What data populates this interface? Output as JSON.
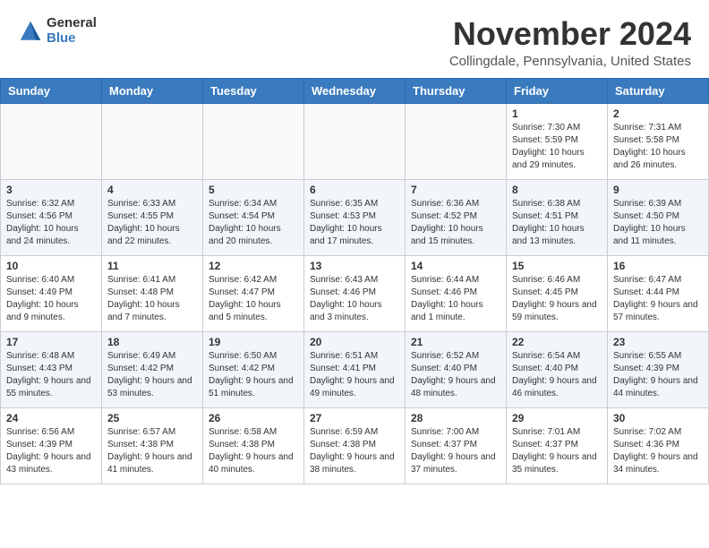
{
  "header": {
    "logo_general": "General",
    "logo_blue": "Blue",
    "month_title": "November 2024",
    "location": "Collingdale, Pennsylvania, United States"
  },
  "calendar": {
    "days_of_week": [
      "Sunday",
      "Monday",
      "Tuesday",
      "Wednesday",
      "Thursday",
      "Friday",
      "Saturday"
    ],
    "weeks": [
      [
        {
          "day": "",
          "info": ""
        },
        {
          "day": "",
          "info": ""
        },
        {
          "day": "",
          "info": ""
        },
        {
          "day": "",
          "info": ""
        },
        {
          "day": "",
          "info": ""
        },
        {
          "day": "1",
          "info": "Sunrise: 7:30 AM\nSunset: 5:59 PM\nDaylight: 10 hours and 29 minutes."
        },
        {
          "day": "2",
          "info": "Sunrise: 7:31 AM\nSunset: 5:58 PM\nDaylight: 10 hours and 26 minutes."
        }
      ],
      [
        {
          "day": "3",
          "info": "Sunrise: 6:32 AM\nSunset: 4:56 PM\nDaylight: 10 hours and 24 minutes."
        },
        {
          "day": "4",
          "info": "Sunrise: 6:33 AM\nSunset: 4:55 PM\nDaylight: 10 hours and 22 minutes."
        },
        {
          "day": "5",
          "info": "Sunrise: 6:34 AM\nSunset: 4:54 PM\nDaylight: 10 hours and 20 minutes."
        },
        {
          "day": "6",
          "info": "Sunrise: 6:35 AM\nSunset: 4:53 PM\nDaylight: 10 hours and 17 minutes."
        },
        {
          "day": "7",
          "info": "Sunrise: 6:36 AM\nSunset: 4:52 PM\nDaylight: 10 hours and 15 minutes."
        },
        {
          "day": "8",
          "info": "Sunrise: 6:38 AM\nSunset: 4:51 PM\nDaylight: 10 hours and 13 minutes."
        },
        {
          "day": "9",
          "info": "Sunrise: 6:39 AM\nSunset: 4:50 PM\nDaylight: 10 hours and 11 minutes."
        }
      ],
      [
        {
          "day": "10",
          "info": "Sunrise: 6:40 AM\nSunset: 4:49 PM\nDaylight: 10 hours and 9 minutes."
        },
        {
          "day": "11",
          "info": "Sunrise: 6:41 AM\nSunset: 4:48 PM\nDaylight: 10 hours and 7 minutes."
        },
        {
          "day": "12",
          "info": "Sunrise: 6:42 AM\nSunset: 4:47 PM\nDaylight: 10 hours and 5 minutes."
        },
        {
          "day": "13",
          "info": "Sunrise: 6:43 AM\nSunset: 4:46 PM\nDaylight: 10 hours and 3 minutes."
        },
        {
          "day": "14",
          "info": "Sunrise: 6:44 AM\nSunset: 4:46 PM\nDaylight: 10 hours and 1 minute."
        },
        {
          "day": "15",
          "info": "Sunrise: 6:46 AM\nSunset: 4:45 PM\nDaylight: 9 hours and 59 minutes."
        },
        {
          "day": "16",
          "info": "Sunrise: 6:47 AM\nSunset: 4:44 PM\nDaylight: 9 hours and 57 minutes."
        }
      ],
      [
        {
          "day": "17",
          "info": "Sunrise: 6:48 AM\nSunset: 4:43 PM\nDaylight: 9 hours and 55 minutes."
        },
        {
          "day": "18",
          "info": "Sunrise: 6:49 AM\nSunset: 4:42 PM\nDaylight: 9 hours and 53 minutes."
        },
        {
          "day": "19",
          "info": "Sunrise: 6:50 AM\nSunset: 4:42 PM\nDaylight: 9 hours and 51 minutes."
        },
        {
          "day": "20",
          "info": "Sunrise: 6:51 AM\nSunset: 4:41 PM\nDaylight: 9 hours and 49 minutes."
        },
        {
          "day": "21",
          "info": "Sunrise: 6:52 AM\nSunset: 4:40 PM\nDaylight: 9 hours and 48 minutes."
        },
        {
          "day": "22",
          "info": "Sunrise: 6:54 AM\nSunset: 4:40 PM\nDaylight: 9 hours and 46 minutes."
        },
        {
          "day": "23",
          "info": "Sunrise: 6:55 AM\nSunset: 4:39 PM\nDaylight: 9 hours and 44 minutes."
        }
      ],
      [
        {
          "day": "24",
          "info": "Sunrise: 6:56 AM\nSunset: 4:39 PM\nDaylight: 9 hours and 43 minutes."
        },
        {
          "day": "25",
          "info": "Sunrise: 6:57 AM\nSunset: 4:38 PM\nDaylight: 9 hours and 41 minutes."
        },
        {
          "day": "26",
          "info": "Sunrise: 6:58 AM\nSunset: 4:38 PM\nDaylight: 9 hours and 40 minutes."
        },
        {
          "day": "27",
          "info": "Sunrise: 6:59 AM\nSunset: 4:38 PM\nDaylight: 9 hours and 38 minutes."
        },
        {
          "day": "28",
          "info": "Sunrise: 7:00 AM\nSunset: 4:37 PM\nDaylight: 9 hours and 37 minutes."
        },
        {
          "day": "29",
          "info": "Sunrise: 7:01 AM\nSunset: 4:37 PM\nDaylight: 9 hours and 35 minutes."
        },
        {
          "day": "30",
          "info": "Sunrise: 7:02 AM\nSunset: 4:36 PM\nDaylight: 9 hours and 34 minutes."
        }
      ]
    ]
  }
}
